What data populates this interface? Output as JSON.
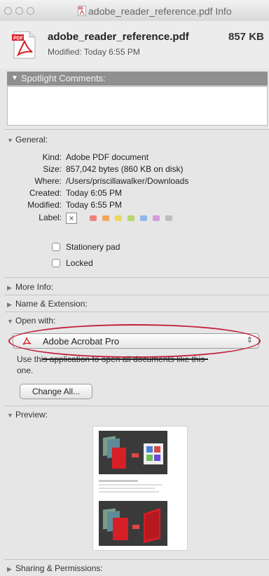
{
  "window": {
    "title": "adobe_reader_reference.pdf Info"
  },
  "header": {
    "file_name": "adobe_reader_reference.pdf",
    "file_size": "857 KB",
    "modified": "Modified: Today 6:55 PM"
  },
  "spotlight": {
    "label": "Spotlight Comments:",
    "value": ""
  },
  "general": {
    "label": "General:",
    "rows": [
      {
        "key": "Kind:",
        "value": "Adobe PDF document"
      },
      {
        "key": "Size:",
        "value": "857,042 bytes (860 KB on disk)"
      },
      {
        "key": "Where:",
        "value": "/Users/priscillawalker/Downloads"
      },
      {
        "key": "Created:",
        "value": "Today 6:05 PM"
      },
      {
        "key": "Modified:",
        "value": "Today 6:55 PM"
      },
      {
        "key": "Label:",
        "value": ""
      }
    ],
    "label_clear": "×",
    "label_colors": [
      "#f08080",
      "#f2a85c",
      "#f0d65a",
      "#b7d86a",
      "#8fb8ea",
      "#d49be0",
      "#bdbdbd"
    ],
    "stationery": {
      "label": "Stationery pad",
      "checked": false
    },
    "locked": {
      "label": "Locked",
      "checked": false
    }
  },
  "more_info": {
    "label": "More Info:"
  },
  "name_extension": {
    "label": "Name & Extension:"
  },
  "open_with": {
    "label": "Open with:",
    "selected_app": "Adobe Acrobat Pro",
    "note_line1": "Use this application to open all documents like this",
    "note_line2": "one.",
    "change_all": "Change All..."
  },
  "preview": {
    "label": "Preview:"
  },
  "sharing": {
    "label": "Sharing & Permissions:"
  },
  "colors": {
    "annotation": "#c21f3a",
    "pdf_red": "#d61f26",
    "section_bar": "#8f8f8f"
  }
}
